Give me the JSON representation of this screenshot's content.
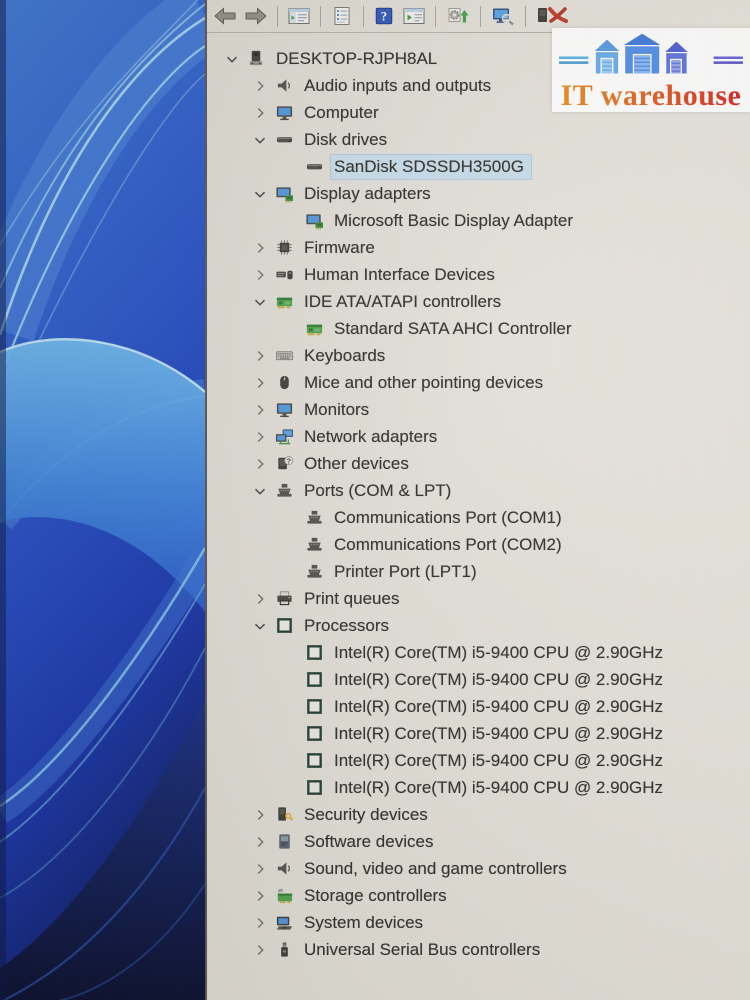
{
  "logo": {
    "text": "IT warehouse"
  },
  "colors": {
    "selection_highlight": "#c6dbe9",
    "logo_text_start": "#e8891e",
    "logo_text_end": "#da1f1f",
    "wallpaper_base": "#1f47bd"
  },
  "toolbar": {
    "items": [
      {
        "kind": "button",
        "name": "back",
        "icon": "back-arrow"
      },
      {
        "kind": "button",
        "name": "forward",
        "icon": "forward-arrow"
      },
      {
        "kind": "separator"
      },
      {
        "kind": "button",
        "name": "show-hide-console-tree",
        "icon": "console-tree"
      },
      {
        "kind": "separator"
      },
      {
        "kind": "button",
        "name": "properties",
        "icon": "properties"
      },
      {
        "kind": "separator"
      },
      {
        "kind": "button",
        "name": "help",
        "icon": "help"
      },
      {
        "kind": "button",
        "name": "show-hide-action-pane",
        "icon": "action-pane"
      },
      {
        "kind": "separator"
      },
      {
        "kind": "button",
        "name": "update-driver",
        "icon": "update-driver"
      },
      {
        "kind": "separator"
      },
      {
        "kind": "button",
        "name": "scan-hardware-changes",
        "icon": "scan-hardware"
      },
      {
        "kind": "separator"
      },
      {
        "kind": "button",
        "name": "uninstall-device",
        "icon": "uninstall"
      }
    ]
  },
  "tree": {
    "rows": [
      {
        "label": "DESKTOP-RJPH8AL",
        "level": 0,
        "chevron": "expanded",
        "icon": "computer"
      },
      {
        "label": "Audio inputs and outputs",
        "level": 1,
        "chevron": "collapsed",
        "icon": "speaker"
      },
      {
        "label": "Computer",
        "level": 1,
        "chevron": "collapsed",
        "icon": "monitor"
      },
      {
        "label": "Disk drives",
        "level": 1,
        "chevron": "expanded",
        "icon": "disk"
      },
      {
        "label": "SanDisk SDSSDH3500G",
        "level": 2,
        "chevron": "none",
        "icon": "disk",
        "selected": true
      },
      {
        "label": "Display adapters",
        "level": 1,
        "chevron": "expanded",
        "icon": "display-adapter"
      },
      {
        "label": "Microsoft Basic Display Adapter",
        "level": 2,
        "chevron": "none",
        "icon": "display-adapter"
      },
      {
        "label": "Firmware",
        "level": 1,
        "chevron": "collapsed",
        "icon": "chip"
      },
      {
        "label": "Human Interface Devices",
        "level": 1,
        "chevron": "collapsed",
        "icon": "hid"
      },
      {
        "label": "IDE ATA/ATAPI controllers",
        "level": 1,
        "chevron": "expanded",
        "icon": "controller-board"
      },
      {
        "label": "Standard SATA AHCI Controller",
        "level": 2,
        "chevron": "none",
        "icon": "controller-board"
      },
      {
        "label": "Keyboards",
        "level": 1,
        "chevron": "collapsed",
        "icon": "keyboard"
      },
      {
        "label": "Mice and other pointing devices",
        "level": 1,
        "chevron": "collapsed",
        "icon": "mouse"
      },
      {
        "label": "Monitors",
        "level": 1,
        "chevron": "collapsed",
        "icon": "monitor"
      },
      {
        "label": "Network adapters",
        "level": 1,
        "chevron": "collapsed",
        "icon": "network"
      },
      {
        "label": "Other devices",
        "level": 1,
        "chevron": "collapsed",
        "icon": "unknown-device"
      },
      {
        "label": "Ports (COM & LPT)",
        "level": 1,
        "chevron": "expanded",
        "icon": "port"
      },
      {
        "label": "Communications Port (COM1)",
        "level": 2,
        "chevron": "none",
        "icon": "port"
      },
      {
        "label": "Communications Port (COM2)",
        "level": 2,
        "chevron": "none",
        "icon": "port"
      },
      {
        "label": "Printer Port (LPT1)",
        "level": 2,
        "chevron": "none",
        "icon": "port"
      },
      {
        "label": "Print queues",
        "level": 1,
        "chevron": "collapsed",
        "icon": "printer"
      },
      {
        "label": "Processors",
        "level": 1,
        "chevron": "expanded",
        "icon": "cpu"
      },
      {
        "label": "Intel(R) Core(TM) i5-9400 CPU @ 2.90GHz",
        "level": 2,
        "chevron": "none",
        "icon": "cpu"
      },
      {
        "label": "Intel(R) Core(TM) i5-9400 CPU @ 2.90GHz",
        "level": 2,
        "chevron": "none",
        "icon": "cpu"
      },
      {
        "label": "Intel(R) Core(TM) i5-9400 CPU @ 2.90GHz",
        "level": 2,
        "chevron": "none",
        "icon": "cpu"
      },
      {
        "label": "Intel(R) Core(TM) i5-9400 CPU @ 2.90GHz",
        "level": 2,
        "chevron": "none",
        "icon": "cpu"
      },
      {
        "label": "Intel(R) Core(TM) i5-9400 CPU @ 2.90GHz",
        "level": 2,
        "chevron": "none",
        "icon": "cpu"
      },
      {
        "label": "Intel(R) Core(TM) i5-9400 CPU @ 2.90GHz",
        "level": 2,
        "chevron": "none",
        "icon": "cpu"
      },
      {
        "label": "Security devices",
        "level": 1,
        "chevron": "collapsed",
        "icon": "security"
      },
      {
        "label": "Software devices",
        "level": 1,
        "chevron": "collapsed",
        "icon": "software"
      },
      {
        "label": "Sound, video and game controllers",
        "level": 1,
        "chevron": "collapsed",
        "icon": "speaker"
      },
      {
        "label": "Storage controllers",
        "level": 1,
        "chevron": "collapsed",
        "icon": "storage"
      },
      {
        "label": "System devices",
        "level": 1,
        "chevron": "collapsed",
        "icon": "system"
      },
      {
        "label": "Universal Serial Bus controllers",
        "level": 1,
        "chevron": "collapsed",
        "icon": "usb"
      }
    ]
  }
}
